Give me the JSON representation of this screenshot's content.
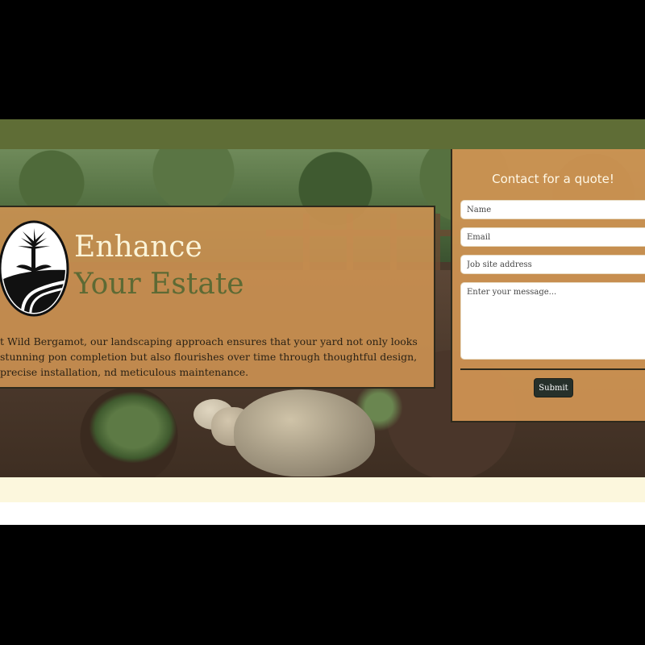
{
  "hero": {
    "headline_line1": "Enhance",
    "headline_line2": "Your Estate",
    "intro_text": "t Wild Bergamot, our landscaping approach ensures that your yard not only looks stunning pon completion but also flourishes over time through thoughtful design, precise installation, nd meticulous maintenance."
  },
  "contact": {
    "title": "Contact for a quote!",
    "name_placeholder": "Name",
    "email_placeholder": "Email",
    "address_placeholder": "Job site address",
    "message_placeholder": "Enter your message...",
    "submit_label": "Submit"
  },
  "colors": {
    "topbar": "#5f6d36",
    "panel": "#cd9252",
    "headline_light": "#fbf4d8",
    "headline_green": "#5d6a34",
    "submit_bg": "#26302a",
    "cream_band": "#fcf7dd"
  },
  "icons": {
    "logo": "palm-tree-logo-icon"
  }
}
